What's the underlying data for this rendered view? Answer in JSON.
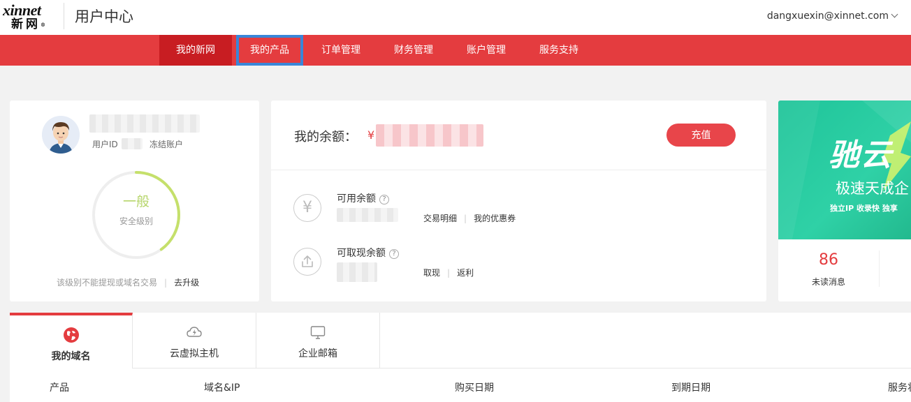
{
  "header": {
    "logo_top": "xinnet",
    "logo_bottom": "新网",
    "app_title": "用户中心",
    "user_email": "dangxuexin@xinnet.com"
  },
  "nav": {
    "items": [
      {
        "label": "我的新网"
      },
      {
        "label": "我的产品"
      },
      {
        "label": "订单管理"
      },
      {
        "label": "财务管理"
      },
      {
        "label": "账户管理"
      },
      {
        "label": "服务支持"
      }
    ]
  },
  "profile": {
    "user_id_label": "用户ID",
    "freeze_link": "冻结账户",
    "security_level": "一般",
    "security_caption": "安全级别",
    "security_progress_pct": 40,
    "note": "该级别不能提现或域名交易",
    "upgrade_link": "去升级"
  },
  "balance": {
    "title": "我的余额：",
    "currency_symbol": "¥",
    "recharge_label": "充值",
    "available_label": "可用余额",
    "available_links": [
      "交易明细",
      "我的优惠券"
    ],
    "withdrawable_label": "可取现余额",
    "withdrawable_links": [
      "取现",
      "返利"
    ],
    "yen_icon": "¥",
    "help_glyph": "?"
  },
  "promo": {
    "headline": "驰云",
    "subline": "极速天成企",
    "tagline": "独立IP 收录快  独享",
    "unread_count": "86",
    "unread_label": "未读消息"
  },
  "tabs": [
    {
      "label": "我的域名"
    },
    {
      "label": "云虚拟主机"
    },
    {
      "label": "企业邮箱"
    }
  ],
  "table": {
    "columns": [
      "产品",
      "域名&IP",
      "购买日期",
      "到期日期",
      "服务状态"
    ]
  },
  "colors": {
    "brand_red": "#e43c3f",
    "nav_active": "#c81d22",
    "highlight_border": "#3a86d8",
    "security_ring": "#c5e06b",
    "promo_green": "#2fd1a6"
  }
}
